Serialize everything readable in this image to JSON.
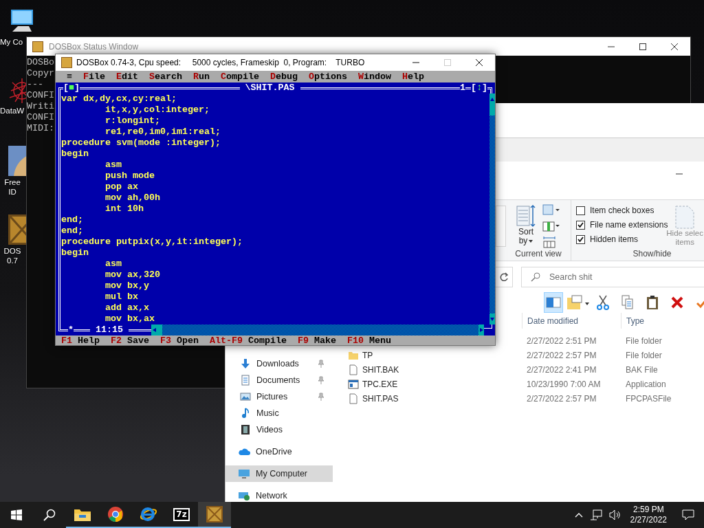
{
  "desktop_icons": [
    {
      "kind": "computer",
      "label_lines": [
        "My Co"
      ]
    },
    {
      "kind": "network",
      "label_lines": [
        "DataW"
      ]
    },
    {
      "kind": "picture",
      "label_lines": [
        "Free",
        "ID"
      ]
    },
    {
      "kind": "app",
      "label_lines": [
        "DOS",
        "0.7"
      ]
    }
  ],
  "status_window": {
    "title": "DOSBox Status Window",
    "lines": [
      "DOSBo",
      "Copyr",
      "---",
      "CONFI",
      "Writi",
      "CONFI",
      "MIDI:"
    ]
  },
  "explorer": {
    "ribbon": {
      "sort_by_lines": [
        "Sort",
        "by"
      ],
      "current_view_label": "Current view",
      "checkboxes": [
        {
          "label": "Item check boxes",
          "checked": false
        },
        {
          "label": "File name extensions",
          "checked": true
        },
        {
          "label": "Hidden items",
          "checked": true
        }
      ],
      "show_hide_label": "Show/hide",
      "hide_selected_lines": [
        "Hide selec",
        "items"
      ]
    },
    "search": {
      "placeholder": "Search shit"
    },
    "toolbar": [
      {
        "kind": "preview-pane",
        "selected": true
      },
      {
        "kind": "properties",
        "selected": false
      },
      {
        "kind": "cut",
        "selected": false
      },
      {
        "kind": "copy",
        "selected": false
      },
      {
        "kind": "paste",
        "selected": false
      },
      {
        "kind": "delete",
        "selected": false
      },
      {
        "kind": "check",
        "selected": false
      }
    ],
    "nav_groups": [
      [
        {
          "label": "Downloads",
          "kind": "downloads",
          "pinned": true,
          "selected": false
        },
        {
          "label": "Documents",
          "kind": "documents",
          "pinned": true,
          "selected": false
        },
        {
          "label": "Pictures",
          "kind": "pictures",
          "pinned": true,
          "selected": false
        },
        {
          "label": "Music",
          "kind": "music",
          "pinned": false,
          "selected": false
        },
        {
          "label": "Videos",
          "kind": "videos",
          "pinned": false,
          "selected": false
        }
      ],
      [
        {
          "label": "OneDrive",
          "kind": "cloud",
          "pinned": false,
          "selected": false
        }
      ],
      [
        {
          "label": "My Computer",
          "kind": "computer",
          "pinned": false,
          "selected": true
        }
      ],
      [
        {
          "label": "Network",
          "kind": "network",
          "pinned": false,
          "selected": false
        }
      ]
    ],
    "columns": [
      "Date modified",
      "Type"
    ],
    "files": [
      {
        "date": "2/27/2022 2:51 PM",
        "type": "File folder"
      },
      {
        "name": "TP",
        "kind": "folder",
        "date": "2/27/2022 2:57 PM",
        "type": "File folder"
      },
      {
        "name": "SHIT.BAK",
        "kind": "file",
        "date": "2/27/2022 2:41 PM",
        "type": "BAK File"
      },
      {
        "name": "TPC.EXE",
        "kind": "application",
        "date": "10/23/1990 7:00 AM",
        "type": "Application"
      },
      {
        "name": "SHIT.PAS",
        "kind": "file",
        "date": "2/27/2022 2:57 PM",
        "type": "FPCPASFile"
      }
    ]
  },
  "dosbox": {
    "title": "DOSBox 0.74-3, Cpu speed:     5000 cycles, Frameskip  0, Program:    TURBO",
    "menu_glyph": "≡",
    "menu": [
      "File",
      "Edit",
      "Search",
      "Run",
      "Compile",
      "Debug",
      "Options",
      "Window",
      "Help"
    ],
    "editor": {
      "close_box": "[■]",
      "title": "\\SHIT.PAS",
      "window_number": "1",
      "zoom_box": "[↕]",
      "lines": [
        "var dx,dy,cx,cy:real;",
        "        it,x,y,col:integer;",
        "        r:longint;",
        "        re1,re0,im0,im1:real;",
        "procedure svm(mode :integer);",
        "begin",
        "        asm",
        "        push mode",
        "        pop ax",
        "        mov ah,00h",
        "        int 10h",
        "end;",
        "end;",
        "procedure putpix(x,y,it:integer);",
        "begin",
        "        asm",
        "        mov ax,320",
        "        mov bx,y",
        "        mul bx",
        "        add ax,x",
        "        mov bx,ax"
      ],
      "modified_mark": "*",
      "cursor_position": "11:15"
    },
    "status_line": [
      {
        "key": "F1",
        "label": "Help"
      },
      {
        "key": "F2",
        "label": "Save"
      },
      {
        "key": "F3",
        "label": "Open"
      },
      {
        "key": "Alt-F9",
        "label": "Compile"
      },
      {
        "key": "F9",
        "label": "Make"
      },
      {
        "key": "F10",
        "label": "Menu"
      }
    ]
  },
  "taskbar": {
    "apps": [
      {
        "kind": "folder",
        "running": true,
        "active": false
      },
      {
        "kind": "browser",
        "running": true,
        "active": false
      },
      {
        "kind": "ie",
        "running": true,
        "active": false
      },
      {
        "kind": "archiver",
        "label": "7z",
        "running": true,
        "active": false
      },
      {
        "kind": "app",
        "running": true,
        "active": true
      }
    ],
    "time": "2:59 PM",
    "date": "2/27/2022"
  }
}
